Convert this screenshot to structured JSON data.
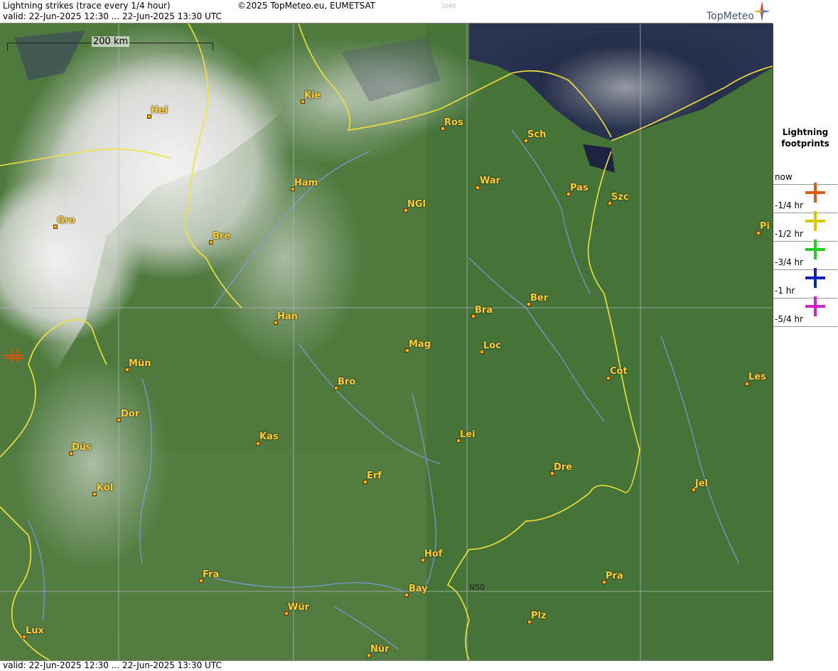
{
  "header": {
    "title": "Lightning strikes (trace every 1/4 hour)",
    "valid": "valid:  22-Jun-2025 12:30 ... 22-Jun-2025 13:30 UTC",
    "copyright": "©2025 TopMeteo.eu, EUMETSAT",
    "code": "3040",
    "logo_text": "TopMeteo"
  },
  "map": {
    "scale_label": "200 km",
    "graticule_label": "N50",
    "cities": [
      "Kie",
      "Hel",
      "Ros",
      "Sch",
      "Ham",
      "War",
      "Pas",
      "Szc",
      "NGl",
      "Gro",
      "Bre",
      "Pi",
      "Ber",
      "Bra",
      "Han",
      "Mag",
      "Loc",
      "Mün",
      "Cot",
      "Les",
      "Bro",
      "Dor",
      "Kas",
      "Lei",
      "Düs",
      "Dre",
      "Erf",
      "Köl",
      "Jel",
      "Hof",
      "Fra",
      "Pra",
      "Bay",
      "Wür",
      "N50-spacer",
      "Plz",
      "Lux",
      "Nür"
    ]
  },
  "legend": {
    "title": "Lightning footprints",
    "rows": [
      {
        "label": "now",
        "color": "#e05a10"
      },
      {
        "label": "-1/4 hr",
        "color": "#d8c800"
      },
      {
        "label": "-1/2 hr",
        "color": "#20d020"
      },
      {
        "label": "-3/4 hr",
        "color": "#1020c0"
      },
      {
        "label": "-1 hr",
        "color": "#d020d0"
      },
      {
        "label": "-5/4 hr",
        "color": ""
      }
    ]
  },
  "footer": {
    "valid": "valid:  22-Jun-2025 12:30 ... 22-Jun-2025 13:30 UTC"
  }
}
